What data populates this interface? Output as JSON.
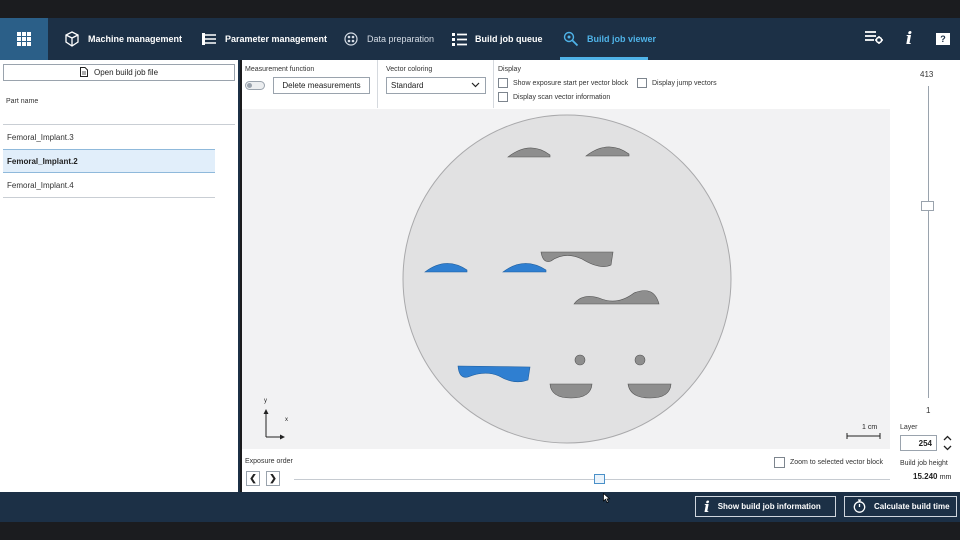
{
  "nav": {
    "tabs": [
      {
        "label": "Machine management",
        "icon": "cube-icon"
      },
      {
        "label": "Parameter management",
        "icon": "list-lines-icon"
      },
      {
        "label": "Data preparation",
        "icon": "dots-circle-icon"
      },
      {
        "label": "Build job queue",
        "icon": "queue-list-icon"
      },
      {
        "label": "Build job viewer",
        "icon": "viewer-search-icon"
      }
    ],
    "active_tab": "Build job viewer",
    "help_label": "?",
    "info_label": "i"
  },
  "left_panel": {
    "open_button_label": "Open build job file",
    "part_name_header": "Part name",
    "parts": [
      "Femoral_Implant.3",
      "Femoral_Implant.2",
      "Femoral_Implant.4"
    ],
    "selected_part": "Femoral_Implant.2"
  },
  "toolbar": {
    "measurement_label": "Measurement function",
    "delete_measurements_label": "Delete measurements",
    "vector_coloring_label": "Vector coloring",
    "vector_coloring_value": "Standard",
    "display_label": "Display",
    "show_exposure_label": "Show exposure start per vector block",
    "display_jump_label": "Display jump vectors",
    "display_scan_label": "Display scan vector information"
  },
  "viewer": {
    "scale_label": "1 cm",
    "axis_x": "x",
    "axis_y": "y",
    "colors": {
      "part": "#8e8e8e",
      "selected": "#2f7fd1",
      "plate": "#e1e1e2"
    }
  },
  "layer": {
    "max": "413",
    "min": "1",
    "label": "Layer",
    "value": "254",
    "current_fraction": 0.614,
    "build_height_label": "Build job height",
    "build_height_value": "15.240",
    "build_height_unit": "mm"
  },
  "exposure": {
    "label": "Exposure order",
    "prev": "❮",
    "next": "❯",
    "zoom_label": "Zoom to selected vector block"
  },
  "bottom": {
    "info_button": "Show build job information",
    "calc_button": "Calculate build time"
  }
}
